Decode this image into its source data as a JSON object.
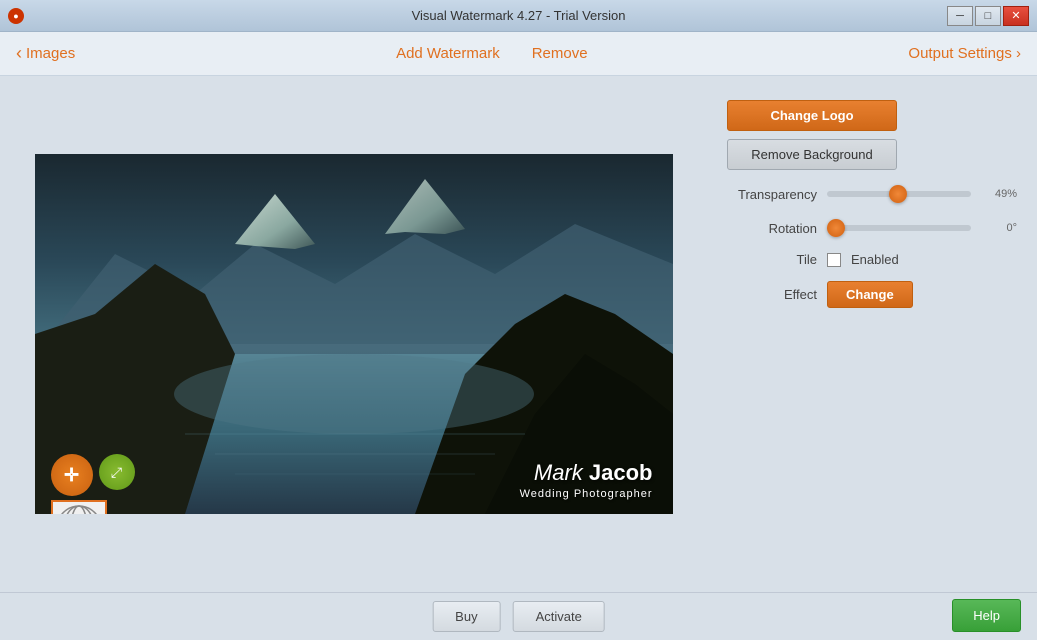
{
  "titlebar": {
    "title": "Visual Watermark 4.27 - Trial Version",
    "min_label": "─",
    "max_label": "□",
    "close_label": "✕"
  },
  "navbar": {
    "back_label": "‹ Images",
    "add_watermark_label": "Add Watermark",
    "remove_label": "Remove",
    "output_label": "Output Settings ›"
  },
  "right_panel": {
    "change_logo_label": "Change Logo",
    "remove_bg_label": "Remove Background",
    "transparency_label": "Transparency",
    "transparency_value": "49%",
    "transparency_pct": 49,
    "rotation_label": "Rotation",
    "rotation_value": "0°",
    "rotation_pct": 0,
    "tile_label": "Tile",
    "tile_enabled_label": "Enabled",
    "effect_label": "Effect",
    "effect_btn_label": "Change"
  },
  "watermark": {
    "name": "Mark Jacob",
    "subtitle": "Wedding Photographer"
  },
  "bottom": {
    "buy_label": "Buy",
    "activate_label": "Activate",
    "help_label": "Help"
  },
  "icons": {
    "move": "✛",
    "resize": "⤢",
    "back_arrow": "‹",
    "forward_arrow": "›"
  }
}
